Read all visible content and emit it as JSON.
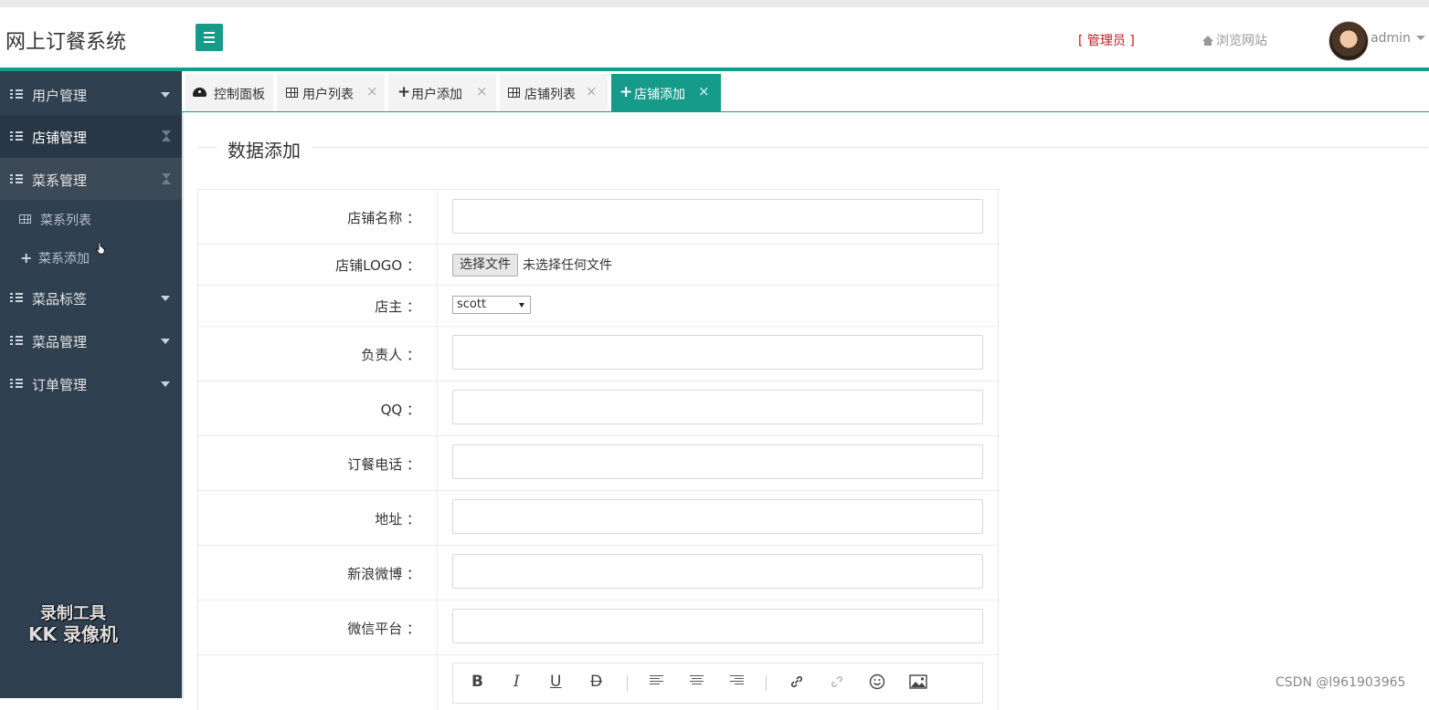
{
  "header": {
    "app_title": "网上订餐系统",
    "role_label": "[ 管理员 ]",
    "browse_label": "浏览网站",
    "user_label": "admin"
  },
  "sidebar": {
    "items": [
      {
        "label": "用户管理"
      },
      {
        "label": "店铺管理"
      },
      {
        "label": "菜系管理"
      },
      {
        "label": "菜系列表"
      },
      {
        "label": "菜系添加"
      },
      {
        "label": "菜品标签"
      },
      {
        "label": "菜品管理"
      },
      {
        "label": "订单管理"
      }
    ],
    "watermark_line1": "录制工具",
    "watermark_line2": "KK 录像机"
  },
  "tabs": [
    {
      "label": "控制面板"
    },
    {
      "label": "用户列表"
    },
    {
      "label": "用户添加"
    },
    {
      "label": "店铺列表"
    },
    {
      "label": "店铺添加"
    }
  ],
  "main": {
    "legend": "数据添加",
    "fields": {
      "shop_name": {
        "label": "店铺名称 ：",
        "value": ""
      },
      "shop_logo": {
        "label": "店铺LOGO ：",
        "button": "选择文件",
        "status": "未选择任何文件"
      },
      "owner": {
        "label": "店主 ：",
        "selected": "scott"
      },
      "manager": {
        "label": "负责人 ：",
        "value": ""
      },
      "qq": {
        "label": "QQ ：",
        "value": ""
      },
      "phone": {
        "label": "订餐电话 ：",
        "value": ""
      },
      "address": {
        "label": "地址 ：",
        "value": ""
      },
      "weibo": {
        "label": "新浪微博 ：",
        "value": ""
      },
      "wechat": {
        "label": "微信平台 ：",
        "value": ""
      }
    },
    "editor_toolbar": {
      "bold": "B",
      "italic": "I",
      "underline": "U",
      "strike": "D"
    }
  },
  "footer_watermark": "CSDN @l961903965",
  "colors": {
    "accent": "#169b8b",
    "sidebar": "#2f4050",
    "role": "#c8161d"
  }
}
